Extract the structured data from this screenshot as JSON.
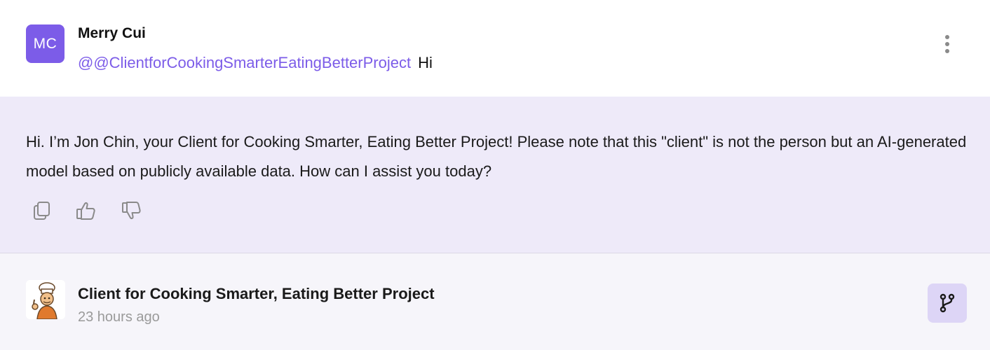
{
  "user_message": {
    "avatar_initials": "MC",
    "author": "Merry Cui",
    "mention": "@@ClientforCookingSmarterEatingBetterProject",
    "text": "Hi",
    "more_icon": "more-vertical-icon"
  },
  "ai_message": {
    "text": "Hi. I’m Jon Chin, your Client for Cooking Smarter, Eating Better Project! Please note that this \"client\" is not the person but an AI-generated model based on publicly available data. How can I assist you today?",
    "actions": [
      {
        "icon": "copy-icon"
      },
      {
        "icon": "thumbs-up-icon"
      },
      {
        "icon": "thumbs-down-icon"
      }
    ]
  },
  "footer": {
    "avatar_icon": "chef-avatar-icon",
    "bot_name": "Client for Cooking Smarter, Eating Better Project",
    "timestamp": "23 hours ago",
    "branch_icon": "branch-icon"
  },
  "colors": {
    "accent": "#7c5ce8",
    "ai_background": "#eeeaf9",
    "branch_button": "#ddd5f6"
  }
}
